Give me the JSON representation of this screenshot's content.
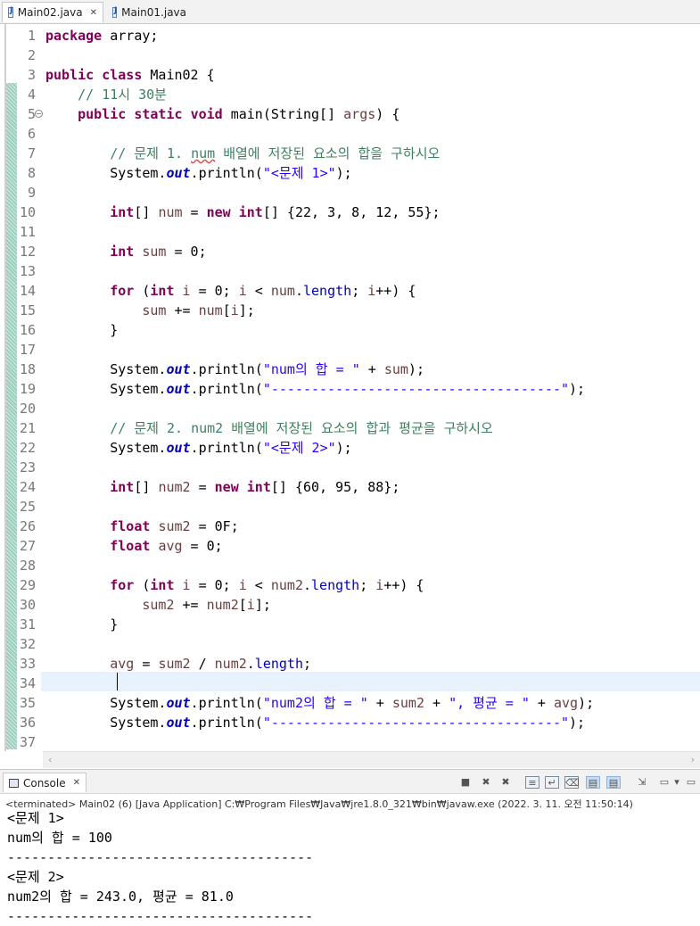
{
  "editor_tabs": [
    {
      "label": "Main02.java",
      "active": true
    },
    {
      "label": "Main01.java",
      "active": false
    }
  ],
  "code_lines": [
    {
      "n": "1",
      "t": "package array;"
    },
    {
      "n": "2",
      "t": ""
    },
    {
      "n": "3",
      "t": "public class Main02 {"
    },
    {
      "n": "4",
      "t": "    // 11시 30분"
    },
    {
      "n": "5",
      "t": "    public static void main(String[] args) {"
    },
    {
      "n": "6",
      "t": ""
    },
    {
      "n": "7",
      "t": "        // 문제 1. num 배열에 저장된 요소의 합을 구하시오"
    },
    {
      "n": "8",
      "t": "        System.out.println(\"<문제 1>\");"
    },
    {
      "n": "9",
      "t": ""
    },
    {
      "n": "10",
      "t": "        int[] num = new int[] {22, 3, 8, 12, 55};"
    },
    {
      "n": "11",
      "t": ""
    },
    {
      "n": "12",
      "t": "        int sum = 0;"
    },
    {
      "n": "13",
      "t": ""
    },
    {
      "n": "14",
      "t": "        for (int i = 0; i < num.length; i++) {"
    },
    {
      "n": "15",
      "t": "            sum += num[i];"
    },
    {
      "n": "16",
      "t": "        }"
    },
    {
      "n": "17",
      "t": ""
    },
    {
      "n": "18",
      "t": "        System.out.println(\"num의 합 = \" + sum);"
    },
    {
      "n": "19",
      "t": "        System.out.println(\"------------------------------------\");"
    },
    {
      "n": "20",
      "t": ""
    },
    {
      "n": "21",
      "t": "        // 문제 2. num2 배열에 저장된 요소의 합과 평균을 구하시오"
    },
    {
      "n": "22",
      "t": "        System.out.println(\"<문제 2>\");"
    },
    {
      "n": "23",
      "t": ""
    },
    {
      "n": "24",
      "t": "        int[] num2 = new int[] {60, 95, 88};"
    },
    {
      "n": "25",
      "t": ""
    },
    {
      "n": "26",
      "t": "        float sum2 = 0F;"
    },
    {
      "n": "27",
      "t": "        float avg = 0;"
    },
    {
      "n": "28",
      "t": ""
    },
    {
      "n": "29",
      "t": "        for (int i = 0; i < num2.length; i++) {"
    },
    {
      "n": "30",
      "t": "            sum2 += num2[i];"
    },
    {
      "n": "31",
      "t": "        }"
    },
    {
      "n": "32",
      "t": ""
    },
    {
      "n": "33",
      "t": "        avg = sum2 / num2.length;"
    },
    {
      "n": "34",
      "t": ""
    },
    {
      "n": "35",
      "t": "        System.out.println(\"num2의 합 = \" + sum2 + \", 평균 = \" + avg);"
    },
    {
      "n": "36",
      "t": "        System.out.println(\"------------------------------------\");"
    },
    {
      "n": "37",
      "t": ""
    }
  ],
  "console": {
    "tab_label": "Console",
    "status": "<terminated> Main02 (6) [Java Application] C:₩Program Files₩Java₩jre1.8.0_321₩bin₩javaw.exe (2022. 3. 11. 오전 11:50:14)",
    "output": [
      "<문제 1>",
      "num의 합 = 100",
      "--------------------------------------",
      "<문제 2>",
      "num2의 합 = 243.0, 평균 = 81.0",
      "--------------------------------------"
    ]
  },
  "toolbar_icons": [
    "terminate-icon",
    "remove-launch-icon",
    "remove-all-terminated-icon",
    "scroll-lock-icon",
    "word-wrap-icon",
    "clear-console-icon",
    "show-on-stdout-icon",
    "show-on-stderr-icon",
    "pin-console-icon",
    "display-console-icon",
    "display-console-dropdown-icon",
    "minimize-icon",
    "maximize-icon"
  ]
}
